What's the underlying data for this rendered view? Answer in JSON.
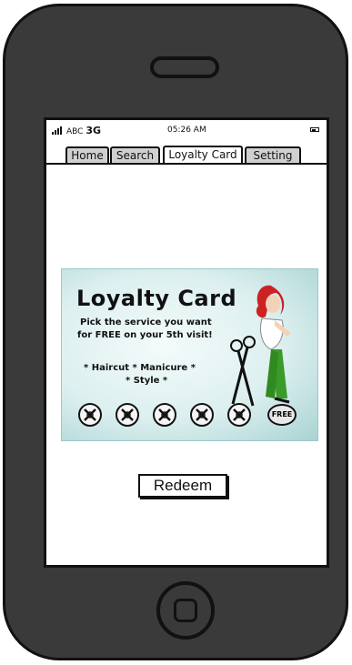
{
  "status_bar": {
    "carrier": "ABC",
    "network": "3G",
    "time": "05:26 AM"
  },
  "tabs": [
    {
      "label": "Home"
    },
    {
      "label": "Search"
    },
    {
      "label": "Loyalty Card",
      "active": true
    },
    {
      "label": "Setting"
    }
  ],
  "card": {
    "title": "Loyalty Card",
    "line1": "Pick the service you want",
    "line2": "for FREE on your 5th visit!",
    "services_line1": "* Haircut  *  Manicure  *",
    "services_line2": "* Style  *",
    "stamps_total": 5,
    "free_label": "FREE",
    "colors": {
      "card_edge": "#a9d3d3",
      "card_center": "#f4fbfb",
      "hair": "#cc2222",
      "pants": "#3a9a2a"
    }
  },
  "redeem_label": "Redeem",
  "icons": [
    "signal-icon",
    "battery-icon",
    "scissors-icon",
    "stamp-icon"
  ]
}
